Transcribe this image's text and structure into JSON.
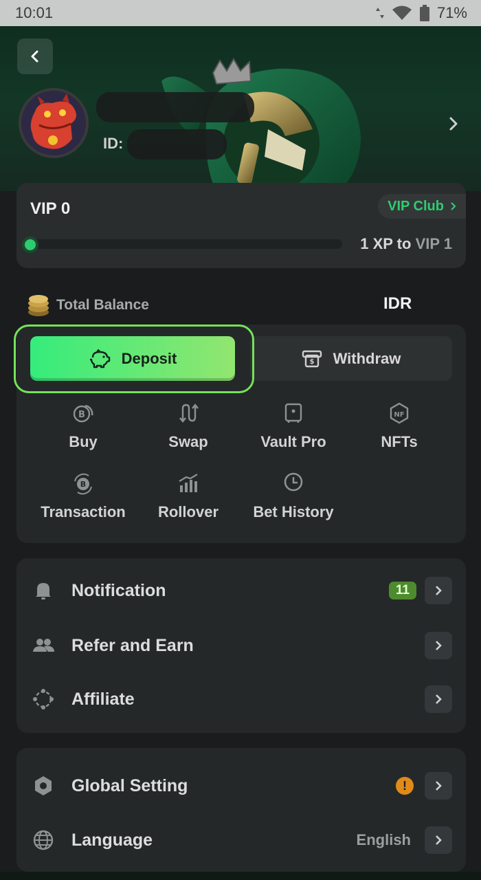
{
  "status_bar": {
    "time": "10:01",
    "battery": "71%"
  },
  "profile": {
    "id_label": "ID:"
  },
  "vip": {
    "level": "VIP 0",
    "club_label": "VIP Club",
    "progress_prefix": "1 XP to",
    "progress_target": "VIP 1",
    "progress_fraction": 0.0
  },
  "balance": {
    "label": "Total Balance",
    "currency": "IDR"
  },
  "actions": {
    "deposit_label": "Deposit",
    "withdraw_label": "Withdraw"
  },
  "quick_actions": [
    {
      "label": "Buy",
      "icon": "bitcoin-coins-icon"
    },
    {
      "label": "Swap",
      "icon": "swap-icon"
    },
    {
      "label": "Vault Pro",
      "icon": "vault-icon"
    },
    {
      "label": "NFTs",
      "icon": "nft-icon"
    },
    {
      "label": "Transaction",
      "icon": "transaction-icon"
    },
    {
      "label": "Rollover",
      "icon": "rollover-icon"
    },
    {
      "label": "Bet History",
      "icon": "clock-icon"
    }
  ],
  "menu_primary": [
    {
      "label": "Notification",
      "icon": "bell-icon",
      "badge": "11"
    },
    {
      "label": "Refer and Earn",
      "icon": "users-icon"
    },
    {
      "label": "Affiliate",
      "icon": "affiliate-icon"
    }
  ],
  "menu_settings": [
    {
      "label": "Global Setting",
      "icon": "hexagon-settings-icon",
      "warning": "!"
    },
    {
      "label": "Language",
      "icon": "globe-icon",
      "value": "English"
    }
  ],
  "colors": {
    "accent_green": "#2ecc71",
    "deposit_gradient_start": "#35ec7c",
    "deposit_gradient_end": "#92e66f",
    "highlight_outline": "#74e35a",
    "background": "#1a1c1d",
    "card": "#252829",
    "warning": "#e08a1a"
  }
}
